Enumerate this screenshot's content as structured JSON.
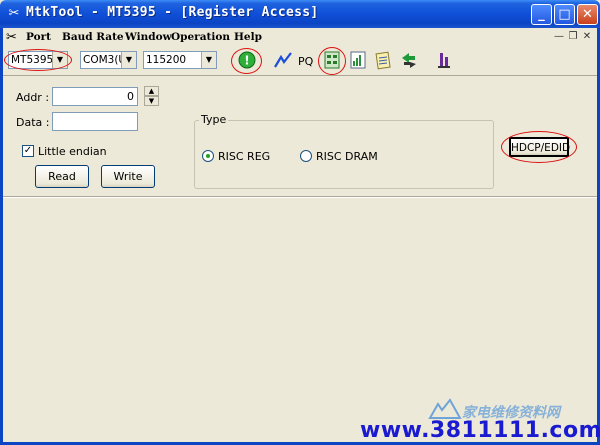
{
  "window": {
    "title": "MtkTool - MT5395 - [Register Access]",
    "title_icon": "mtk-tool-icon",
    "controls": [
      "minimize",
      "maximize",
      "close"
    ]
  },
  "menubar": {
    "items": [
      "Port",
      "Baud Rate",
      "Window",
      "Operation",
      "Help"
    ],
    "mdi_controls": [
      "minimize",
      "restore",
      "close"
    ]
  },
  "toolbar": {
    "chip_select": "MT5395",
    "port_select": "COM3(U",
    "baud_select": "115200",
    "pq_label": "PQ",
    "icons": [
      "connect-icon",
      "waveform-icon",
      "register-grid-icon",
      "chart-icon",
      "notes-icon",
      "transfer-icon",
      "tool-icon"
    ]
  },
  "form": {
    "addr_label": "Addr :",
    "addr_value": "0",
    "data_label": "Data :",
    "data_value": "",
    "little_endian_label": "Little endian",
    "little_endian_checked": true,
    "read_label": "Read",
    "write_label": "Write",
    "type_label": "Type",
    "risc_reg_label": "RISC REG",
    "risc_dram_label": "RISC DRAM",
    "hdcp_label": "HDCP/EDID"
  },
  "watermark": {
    "url": "www.3811111.com",
    "cn": "家电维修资料网"
  },
  "colors": {
    "annotation": "#dd1111",
    "title_bar": "#0b45c4"
  }
}
